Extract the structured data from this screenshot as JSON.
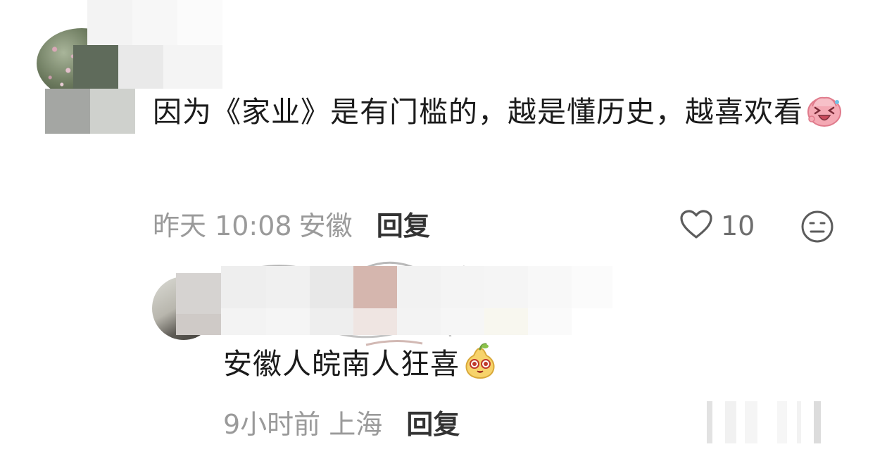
{
  "comment": {
    "text": "因为《家业》是有门槛的，越是懂历史，越喜欢看",
    "emoji_icon": "laughing-face-sticker",
    "time": "昨天 10:08",
    "location": "安徽",
    "reply_label": "回复",
    "like_icon": "heart-outline-icon",
    "like_count": "10",
    "dislike_icon": "neutral-face-icon"
  },
  "reply": {
    "text": "安徽人皖南人狂喜",
    "emoji_icon": "pear-face-sticker",
    "time": "9小时前",
    "location": "上海",
    "reply_label": "回复"
  },
  "colors": {
    "text": "#1b1b1b",
    "meta": "#9a9a9a",
    "action": "#333333"
  }
}
